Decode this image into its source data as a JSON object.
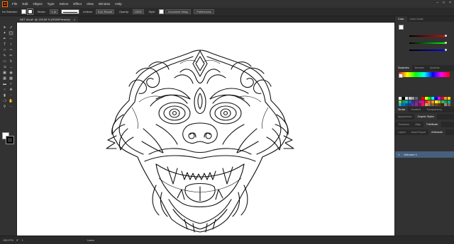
{
  "menu": {
    "logo": "Ai",
    "items": [
      "File",
      "Edit",
      "Object",
      "Type",
      "Select",
      "Effect",
      "View",
      "Window",
      "Help"
    ]
  },
  "control": {
    "no_selection": "No Selection",
    "stroke_label": "Stroke:",
    "stroke_value": "1 pt",
    "profile": "Uniform",
    "brush": "5 pt. Round",
    "opacity_label": "Opacity:",
    "opacity_value": "100%",
    "style_label": "Style:",
    "doc_setup": "Document Setup",
    "preferences": "Preferences"
  },
  "document": {
    "tab_title": "NET Art.ai* @ 135.89 % (RGB/Preview)",
    "close": "×"
  },
  "status": {
    "zoom": "135.07%",
    "angle": "0°",
    "artboard_num": "1",
    "tool_name": "Lasso"
  },
  "panels": {
    "color_tabs": [
      "Color",
      "Color Guide"
    ],
    "swatch_tabs": [
      "Swatches",
      "Brushes",
      "Symbols"
    ],
    "stroke_tabs": [
      "Stroke",
      "Gradient",
      "Transparency"
    ],
    "appearance_tabs": [
      "Appearance",
      "Graphic Styles"
    ],
    "transform_tabs": [
      "Transform",
      "Align",
      "Pathfinder"
    ],
    "layers_tabs": [
      "Layers",
      "Asset Export",
      "Artboards"
    ],
    "artboard_item_num": "1",
    "artboard_item_name": "Artboard 1"
  },
  "colors": {
    "accent": "#46607e",
    "ai_orange": "#ff9a00",
    "ui_bg": "#323232"
  }
}
